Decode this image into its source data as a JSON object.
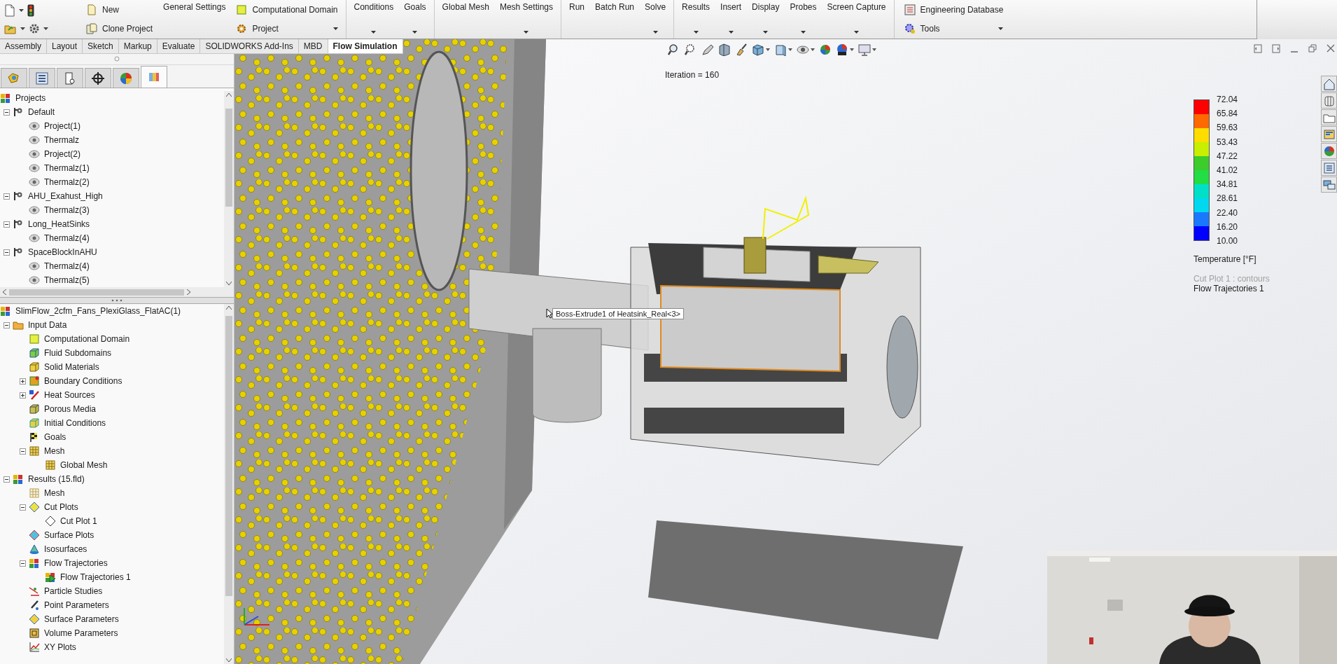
{
  "ribbon": {
    "groups": [
      {
        "columns": [
          [
            {
              "label": "New",
              "kind": "new"
            },
            {
              "label": "Clone Project",
              "kind": "clone"
            }
          ],
          [
            {
              "label": "General Settings",
              "kind": "command"
            }
          ],
          [
            {
              "label": "Computational Domain",
              "kind": "domain"
            },
            {
              "label": "Project",
              "kind": "project",
              "dropdown": true
            }
          ]
        ]
      },
      {
        "columns": [
          [
            {
              "label": "Conditions",
              "kind": "command",
              "dropdown": true
            }
          ],
          [
            {
              "label": "Goals",
              "kind": "command",
              "dropdown": true
            }
          ]
        ]
      },
      {
        "columns": [
          [
            {
              "label": "Global Mesh",
              "kind": "command"
            }
          ],
          [
            {
              "label": "Mesh Settings",
              "kind": "command",
              "dropdown": true
            }
          ]
        ]
      },
      {
        "columns": [
          [
            {
              "label": "Run",
              "kind": "command"
            }
          ],
          [
            {
              "label": "Batch Run",
              "kind": "command"
            }
          ],
          [
            {
              "label": "Solve",
              "kind": "command",
              "dropdown": true
            }
          ]
        ]
      },
      {
        "columns": [
          [
            {
              "label": "Results",
              "kind": "command",
              "dropdown": true
            }
          ],
          [
            {
              "label": "Insert",
              "kind": "command",
              "dropdown": true
            }
          ],
          [
            {
              "label": "Display",
              "kind": "command",
              "dropdown": true
            }
          ],
          [
            {
              "label": "Probes",
              "kind": "command",
              "dropdown": true
            }
          ],
          [
            {
              "label": "Screen Capture",
              "kind": "command",
              "dropdown": true
            }
          ]
        ]
      },
      {
        "columns": [
          [
            {
              "label": "Engineering Database",
              "kind": "database"
            },
            {
              "label": "Tools",
              "kind": "tools",
              "dropdown": true
            }
          ]
        ]
      }
    ]
  },
  "command_tabs": [
    {
      "label": "Assembly",
      "selected": false
    },
    {
      "label": "Layout",
      "selected": false
    },
    {
      "label": "Sketch",
      "selected": false
    },
    {
      "label": "Markup",
      "selected": false
    },
    {
      "label": "Evaluate",
      "selected": false
    },
    {
      "label": "SOLIDWORKS Add-Ins",
      "selected": false
    },
    {
      "label": "MBD",
      "selected": false
    },
    {
      "label": "Flow Simulation",
      "selected": true
    }
  ],
  "panel_tabs": [
    {
      "selected": false
    },
    {
      "selected": false
    },
    {
      "selected": false
    },
    {
      "selected": false
    },
    {
      "selected": false
    },
    {
      "selected": true
    }
  ],
  "project_tree": {
    "label": "Projects",
    "kind": "projects",
    "children": [
      {
        "label": "Default",
        "kind": "config",
        "expanded": true,
        "children": [
          {
            "label": "Project(1)",
            "kind": "project"
          },
          {
            "label": "Thermalz",
            "kind": "project"
          },
          {
            "label": "Project(2)",
            "kind": "project"
          },
          {
            "label": "Thermalz(1)",
            "kind": "project"
          },
          {
            "label": "Thermalz(2)",
            "kind": "project"
          }
        ]
      },
      {
        "label": "AHU_Exahust_High",
        "kind": "config",
        "expanded": true,
        "children": [
          {
            "label": "Thermalz(3)",
            "kind": "project"
          }
        ]
      },
      {
        "label": "Long_HeatSinks",
        "kind": "config",
        "expanded": true,
        "children": [
          {
            "label": "Thermalz(4)",
            "kind": "project"
          }
        ]
      },
      {
        "label": "SpaceBlockInAHU",
        "kind": "config",
        "expanded": true,
        "children": [
          {
            "label": "Thermalz(4)",
            "kind": "project"
          },
          {
            "label": "Thermalz(5)",
            "kind": "project"
          }
        ]
      }
    ]
  },
  "analysis_tree": {
    "label": "SlimFlow_2cfm_Fans_PlexiGlass_FlatAC(1)",
    "kind": "analysis",
    "children": [
      {
        "label": "Input Data",
        "kind": "input",
        "expanded": true,
        "children": [
          {
            "label": "Computational Domain",
            "kind": "domain"
          },
          {
            "label": "Fluid Subdomains",
            "kind": "subdomain"
          },
          {
            "label": "Solid Materials",
            "kind": "material"
          },
          {
            "label": "Boundary Conditions",
            "kind": "boundary",
            "expanded": false
          },
          {
            "label": "Heat Sources",
            "kind": "heat",
            "expanded": false
          },
          {
            "label": "Porous Media",
            "kind": "porous"
          },
          {
            "label": "Initial Conditions",
            "kind": "initial"
          },
          {
            "label": "Goals",
            "kind": "goals"
          },
          {
            "label": "Mesh",
            "kind": "mesh",
            "expanded": true,
            "children": [
              {
                "label": "Global Mesh",
                "kind": "mesh"
              }
            ]
          }
        ]
      },
      {
        "label": "Results (15.fld)",
        "kind": "results",
        "expanded": true,
        "children": [
          {
            "label": "Mesh",
            "kind": "grid"
          },
          {
            "label": "Cut Plots",
            "kind": "cutplots",
            "expanded": true,
            "children": [
              {
                "label": "Cut Plot 1",
                "kind": "cutplot"
              }
            ]
          },
          {
            "label": "Surface Plots",
            "kind": "surface"
          },
          {
            "label": "Isosurfaces",
            "kind": "iso"
          },
          {
            "label": "Flow Trajectories",
            "kind": "trajectories",
            "expanded": true,
            "children": [
              {
                "label": "Flow Trajectories 1",
                "kind": "trajectory"
              }
            ]
          },
          {
            "label": "Particle Studies",
            "kind": "particle"
          },
          {
            "label": "Point Parameters",
            "kind": "point"
          },
          {
            "label": "Surface Parameters",
            "kind": "surfparam"
          },
          {
            "label": "Volume Parameters",
            "kind": "volume"
          },
          {
            "label": "XY Plots",
            "kind": "xy"
          }
        ]
      }
    ]
  },
  "viewport": {
    "iteration_label": "Iteration = 160",
    "tooltip": "Boss-Extrude1 of Heatsink_Real<3>",
    "legend": {
      "scale_labels": [
        "72.04",
        "65.84",
        "59.63",
        "53.43",
        "47.22",
        "41.02",
        "34.81",
        "28.61",
        "22.40",
        "16.20",
        "10.00"
      ],
      "bands": [
        {
          "color": "#ff0000"
        },
        {
          "color": "#ff6a00"
        },
        {
          "color": "#ffdd00"
        },
        {
          "color": "#c8ee00"
        },
        {
          "color": "#3ccc2c"
        },
        {
          "color": "#22dd44"
        },
        {
          "color": "#00e0c8"
        },
        {
          "color": "#00d8f0"
        },
        {
          "color": "#1a78ff"
        },
        {
          "color": "#0000ff"
        }
      ],
      "title": "Temperature [°F]",
      "plots": [
        {
          "label": "Cut Plot 1 : contours",
          "active": false
        },
        {
          "label": "Flow Trajectories 1",
          "active": true
        }
      ]
    }
  }
}
